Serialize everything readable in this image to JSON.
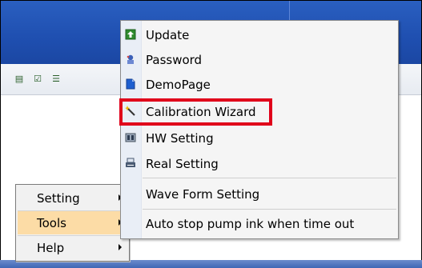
{
  "left_menu": {
    "items": [
      {
        "label": "Setting",
        "has_submenu": true,
        "selected": false
      },
      {
        "label": "Tools",
        "has_submenu": true,
        "selected": true
      },
      {
        "label": "Help",
        "has_submenu": true,
        "selected": false
      }
    ]
  },
  "submenu": {
    "items": [
      {
        "label": "Update",
        "icon": "update-icon"
      },
      {
        "label": "Password",
        "icon": "password-icon"
      },
      {
        "label": "DemoPage",
        "icon": "demopage-icon"
      },
      {
        "label": "Calibration Wizard",
        "icon": "wizard-wand-icon",
        "highlighted": true
      },
      {
        "label": "HW Setting",
        "icon": "hw-setting-icon"
      },
      {
        "label": "Real Setting",
        "icon": "real-setting-icon"
      },
      {
        "label": "Wave Form Setting",
        "icon": ""
      },
      {
        "label": "Auto stop pump ink when time out",
        "icon": ""
      }
    ]
  },
  "colors": {
    "highlight_border": "#e0001a",
    "menu_selected_bg": "#fcdca6",
    "titlebar_blue": "#1f4fb0"
  }
}
